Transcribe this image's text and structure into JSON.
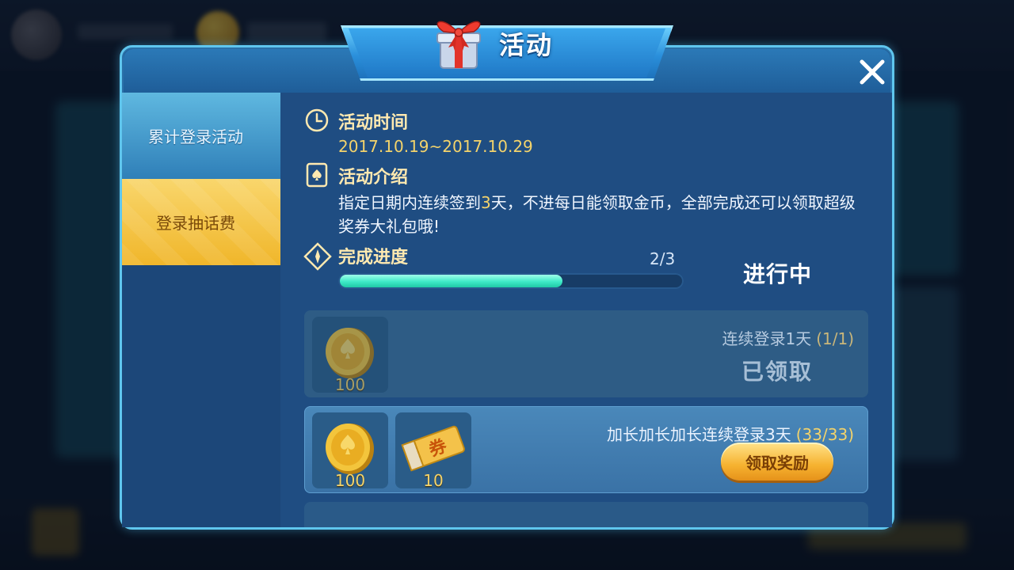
{
  "header": {
    "title": "活动"
  },
  "sidebar": {
    "items": [
      {
        "label": "累计登录活动"
      },
      {
        "label": "登录抽话费"
      }
    ]
  },
  "activity": {
    "time_label": "活动时间",
    "time_value": "2017.10.19~2017.10.29",
    "intro_label": "活动介绍",
    "intro_pre": "指定日期内连续签到",
    "intro_days": "3",
    "intro_post": "天，不进每日能领取金币，全部完成还可以领取超级奖券大礼包哦!",
    "progress_label": "完成进度",
    "progress_count": "2/3",
    "progress_fraction": 0.65,
    "status": "进行中"
  },
  "rewards": [
    {
      "title": "连续登录1天",
      "count": "(1/1)",
      "state_label": "已领取",
      "items": [
        {
          "icon": "coin-icon",
          "amount": "100"
        }
      ]
    },
    {
      "title": "加长加长加长连续登录3天",
      "count": "(33/33)",
      "button_label": "领取奖励",
      "items": [
        {
          "icon": "coin-icon",
          "amount": "100"
        },
        {
          "icon": "ticket-icon",
          "amount": "10",
          "ticket_text": "券"
        }
      ]
    }
  ],
  "colors": {
    "accent": "#3ee9c7",
    "gold": "#f3d36b",
    "panel": "#1f4d82",
    "border": "#5fc6ee"
  }
}
